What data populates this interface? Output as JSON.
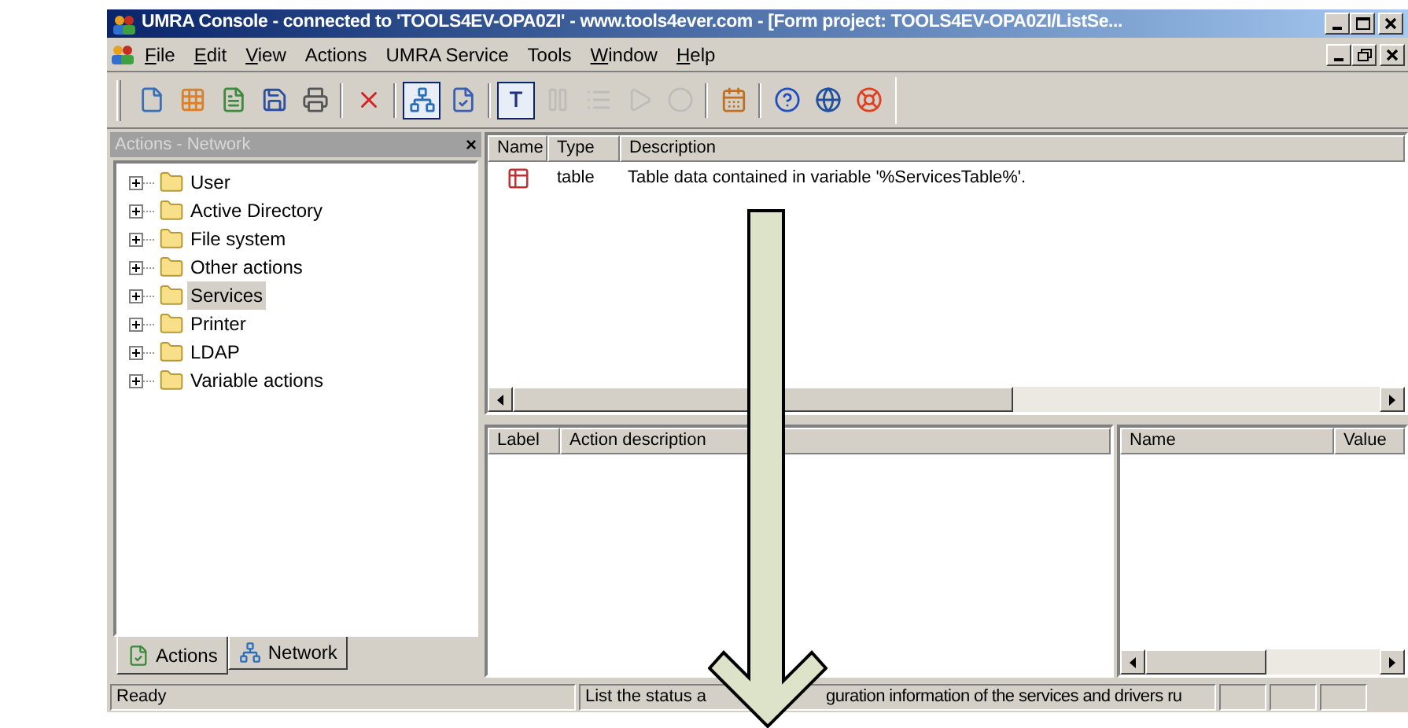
{
  "window": {
    "title": "UMRA Console - connected to 'TOOLS4EV-OPA0ZI' - www.tools4ever.com - [Form project: TOOLS4EV-OPA0ZI/ListSe..."
  },
  "menu": [
    {
      "label": "File",
      "underlined": true
    },
    {
      "label": "Edit",
      "underlined": true
    },
    {
      "label": "View",
      "underlined": true
    },
    {
      "label": "Actions",
      "underlined": false
    },
    {
      "label": "UMRA Service",
      "underlined": false
    },
    {
      "label": "Tools",
      "underlined": false
    },
    {
      "label": "Window",
      "underlined": true
    },
    {
      "label": "Help",
      "underlined": true
    }
  ],
  "toolbar": [
    {
      "kind": "new",
      "pressed": false,
      "disabled": false
    },
    {
      "kind": "grid",
      "pressed": false,
      "disabled": false
    },
    {
      "kind": "sheet",
      "pressed": false,
      "disabled": false
    },
    {
      "kind": "save",
      "pressed": false,
      "disabled": false
    },
    {
      "kind": "print",
      "pressed": false,
      "disabled": false
    },
    {
      "kind": "sep"
    },
    {
      "kind": "delete",
      "pressed": false,
      "disabled": false
    },
    {
      "kind": "sep"
    },
    {
      "kind": "network",
      "pressed": true,
      "disabled": false
    },
    {
      "kind": "form",
      "pressed": false,
      "disabled": false
    },
    {
      "kind": "sep"
    },
    {
      "kind": "text",
      "pressed": true,
      "disabled": false
    },
    {
      "kind": "pause",
      "pressed": false,
      "disabled": true
    },
    {
      "kind": "list",
      "pressed": false,
      "disabled": true
    },
    {
      "kind": "play",
      "pressed": false,
      "disabled": true
    },
    {
      "kind": "stop",
      "pressed": false,
      "disabled": true
    },
    {
      "kind": "sep"
    },
    {
      "kind": "calendar",
      "pressed": false,
      "disabled": false
    },
    {
      "kind": "sep"
    },
    {
      "kind": "help",
      "pressed": false,
      "disabled": false
    },
    {
      "kind": "globe",
      "pressed": false,
      "disabled": false
    },
    {
      "kind": "lifebuoy",
      "pressed": false,
      "disabled": false
    }
  ],
  "left_panel": {
    "title": "Actions - Network",
    "close": "×",
    "tree": [
      {
        "label": "User",
        "expanded": false,
        "selected": false
      },
      {
        "label": "Active Directory",
        "expanded": false,
        "selected": false
      },
      {
        "label": "File system",
        "expanded": false,
        "selected": false
      },
      {
        "label": "Other actions",
        "expanded": false,
        "selected": false
      },
      {
        "label": "Services",
        "expanded": false,
        "selected": true
      },
      {
        "label": "Printer",
        "expanded": false,
        "selected": false
      },
      {
        "label": "LDAP",
        "expanded": false,
        "selected": false
      },
      {
        "label": "Variable actions",
        "expanded": false,
        "selected": false
      }
    ],
    "tabs": [
      {
        "label": "Actions",
        "selected": true
      },
      {
        "label": "Network",
        "selected": false
      }
    ]
  },
  "variables_table": {
    "columns": [
      "Name",
      "Type",
      "Description"
    ],
    "rows": [
      {
        "type": "table",
        "description": "Table data contained in variable '%ServicesTable%'."
      }
    ]
  },
  "actions_table": {
    "columns": [
      "Label",
      "Action description"
    ]
  },
  "properties_table": {
    "columns": [
      "Name",
      "Value"
    ]
  },
  "status_bar": {
    "left": "Ready",
    "message_parts": [
      "List the status a",
      "guration information of the services and drivers ru"
    ]
  }
}
